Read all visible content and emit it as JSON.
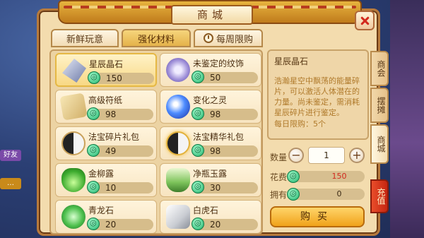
{
  "window": {
    "title": "商城"
  },
  "tabs": [
    {
      "label": "新鲜玩意",
      "active": false
    },
    {
      "label": "强化材料",
      "active": true
    },
    {
      "label": "每周限购",
      "active": false,
      "icon": "clock-icon"
    }
  ],
  "items": [
    {
      "name": "星辰晶石",
      "price": "150",
      "icon": "crystal-icon",
      "selected": true
    },
    {
      "name": "未鉴定的纹饰",
      "price": "50",
      "icon": "ornament-icon"
    },
    {
      "name": "高级符纸",
      "price": "98",
      "icon": "talisman-paper-icon"
    },
    {
      "name": "变化之灵",
      "price": "98",
      "icon": "spirit-orb-icon"
    },
    {
      "name": "法宝碎片礼包",
      "price": "49",
      "icon": "yinyang-icon"
    },
    {
      "name": "法宝精华礼包",
      "price": "98",
      "icon": "yinyang-gold-icon"
    },
    {
      "name": "金柳露",
      "price": "10",
      "icon": "green-elixir-icon"
    },
    {
      "name": "净瓶玉露",
      "price": "30",
      "icon": "jade-bottle-icon"
    },
    {
      "name": "青龙石",
      "price": "20",
      "icon": "azure-dragon-stone-icon"
    },
    {
      "name": "白虎石",
      "price": "20",
      "icon": "white-tiger-stone-icon"
    }
  ],
  "detail": {
    "title": "星辰晶石",
    "description": "浩瀚星空中飘荡的能量碎片，可以激活人体潜在的力量。尚未鉴定，需消耗星辰碎片进行鉴定。",
    "limit": "每日限购：5个",
    "quantity_label": "数量",
    "quantity": "1",
    "cost_label": "花费",
    "cost": "150",
    "owned_label": "拥有",
    "owned": "0",
    "buy_label": "购买"
  },
  "side_tabs": [
    {
      "label": "商会",
      "active": false
    },
    {
      "label": "摆摊",
      "active": false
    },
    {
      "label": "商城",
      "active": true
    },
    {
      "label": "充值",
      "active": false
    }
  ],
  "background": {
    "tag1": "好友"
  },
  "colors": {
    "accent": "#f0a21a",
    "cost_red": "#d2281d",
    "coin": "#1fb06a"
  }
}
